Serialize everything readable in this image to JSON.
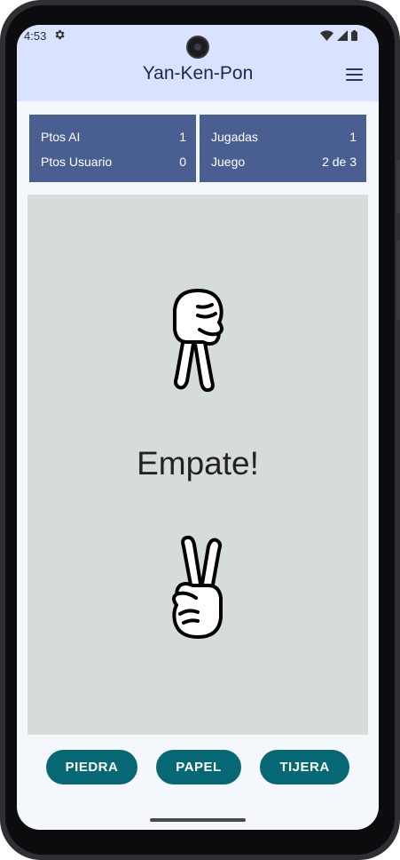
{
  "status_bar": {
    "time": "4:53",
    "icons": [
      "settings-icon",
      "wifi-icon",
      "signal-icon",
      "battery-icon"
    ]
  },
  "app_bar": {
    "title": "Yan-Ken-Pon",
    "menu_icon": "hamburger-menu-icon"
  },
  "scoreboard": {
    "left": [
      {
        "label": "Ptos AI",
        "value": "1"
      },
      {
        "label": "Ptos Usuario",
        "value": "0"
      }
    ],
    "right": [
      {
        "label": "Jugadas",
        "value": "1"
      },
      {
        "label": "Juego",
        "value": "2 de 3"
      }
    ]
  },
  "game": {
    "ai_hand": "scissors-hand-icon",
    "user_hand": "scissors-hand-icon",
    "result": "Empate!"
  },
  "actions": [
    {
      "label": "PIEDRA"
    },
    {
      "label": "PAPEL"
    },
    {
      "label": "TIJERA"
    }
  ],
  "colors": {
    "app_bar_bg": "#d9e2ff",
    "score_card_bg": "#4a5f91",
    "game_area_bg": "#d5dcda",
    "button_bg": "#066874",
    "screen_bg": "#f4f8fd"
  }
}
